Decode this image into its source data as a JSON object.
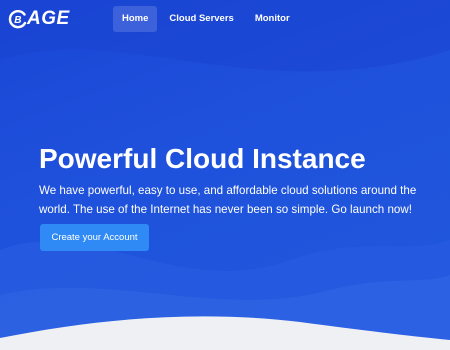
{
  "brand": {
    "name": "AGE",
    "mark_letter": "B"
  },
  "nav": {
    "items": [
      {
        "label": "Home",
        "active": true
      },
      {
        "label": "Cloud Servers",
        "active": false
      },
      {
        "label": "Monitor",
        "active": false
      }
    ]
  },
  "hero": {
    "title": "Powerful Cloud Instance",
    "subtitle": "We have powerful, easy to use, and affordable cloud solutions around the world. The use of the Internet has never been so simple. Go launch now!",
    "cta_label": "Create your Account"
  },
  "colors": {
    "background": "#1f52dc",
    "cta": "#2f8af6",
    "bottom_wave": "#eef0f4"
  }
}
